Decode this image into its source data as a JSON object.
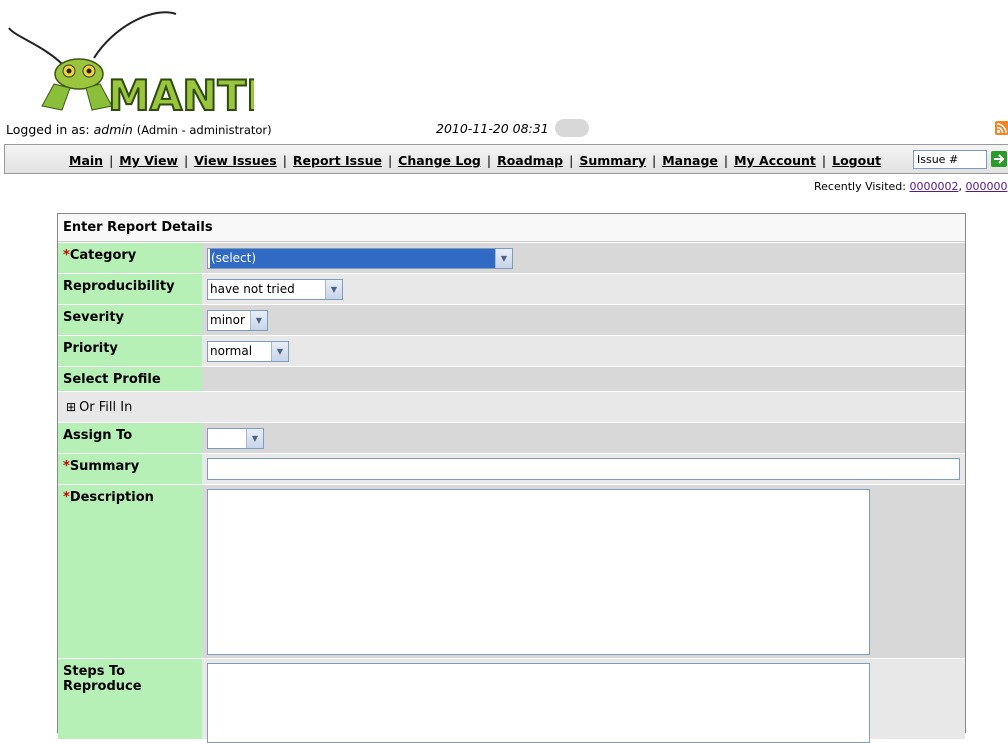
{
  "logo": {
    "text": "MANTIS"
  },
  "login": {
    "prefix": "Logged in as:",
    "username": "admin",
    "role": "(Admin - administrator)"
  },
  "clock": "2010-11-20 08:31",
  "menu": {
    "items": [
      "Main",
      "My View",
      "View Issues",
      "Report Issue",
      "Change Log",
      "Roadmap",
      "Summary",
      "Manage",
      "My Account",
      "Logout"
    ],
    "issue_placeholder": "Issue #"
  },
  "recently_visited": {
    "label": "Recently Visited:",
    "items": [
      "0000002",
      "000000"
    ]
  },
  "form": {
    "title": "Enter Report Details",
    "required_marker": "*",
    "category": {
      "label": "Category",
      "value": "(select)"
    },
    "reproducibility": {
      "label": "Reproducibility",
      "value": "have not tried"
    },
    "severity": {
      "label": "Severity",
      "value": "minor"
    },
    "priority": {
      "label": "Priority",
      "value": "normal"
    },
    "select_profile": {
      "label": "Select Profile"
    },
    "or_fill_in": {
      "label": "Or Fill In",
      "toggle": "⊞"
    },
    "assign_to": {
      "label": "Assign To",
      "value": ""
    },
    "summary": {
      "label": "Summary",
      "value": ""
    },
    "description": {
      "label": "Description",
      "value": ""
    },
    "steps_to_reproduce": {
      "label_line1": "Steps To",
      "label_line2": "Reproduce",
      "value": ""
    }
  },
  "colors": {
    "label_bg": "#b7f0b7",
    "required": "#cc0000",
    "selected": "#316ac5",
    "rss": "#f78422",
    "go": "#2a9a2a"
  }
}
